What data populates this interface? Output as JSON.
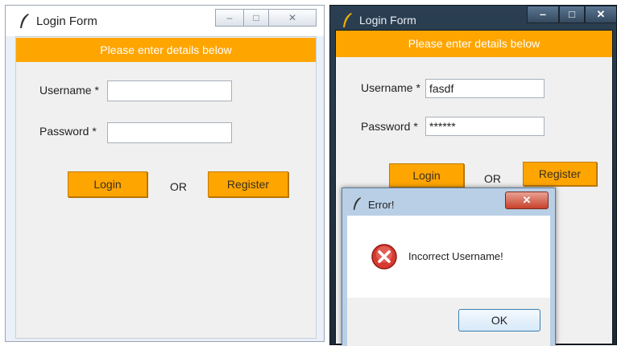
{
  "left_window": {
    "title": "Login Form",
    "controls": {
      "minimize": "‒",
      "maximize": "□",
      "close": "✕"
    },
    "banner": "Please enter details below",
    "username_label": "Username *",
    "username_value": "",
    "password_label": "Password *",
    "password_value": "",
    "login_label": "Login",
    "or_label": "OR",
    "register_label": "Register"
  },
  "right_window": {
    "title": "Login Form",
    "controls": {
      "minimize": "‒",
      "maximize": "□",
      "close": "✕"
    },
    "banner": "Please enter details below",
    "username_label": "Username *",
    "username_value": "fasdf",
    "password_label": "Password *",
    "password_value": "******",
    "login_label": "Login",
    "or_label": "OR",
    "register_label": "Register"
  },
  "error_dialog": {
    "title": "Error!",
    "close_glyph": "✕",
    "icon": "error-icon",
    "message": "Incorrect Username!",
    "ok_label": "OK"
  },
  "colors": {
    "accent_orange": "#ffa500",
    "banner_text": "#ffffff",
    "error_red": "#c0282a",
    "dialog_frame": "#b9cfe6"
  }
}
